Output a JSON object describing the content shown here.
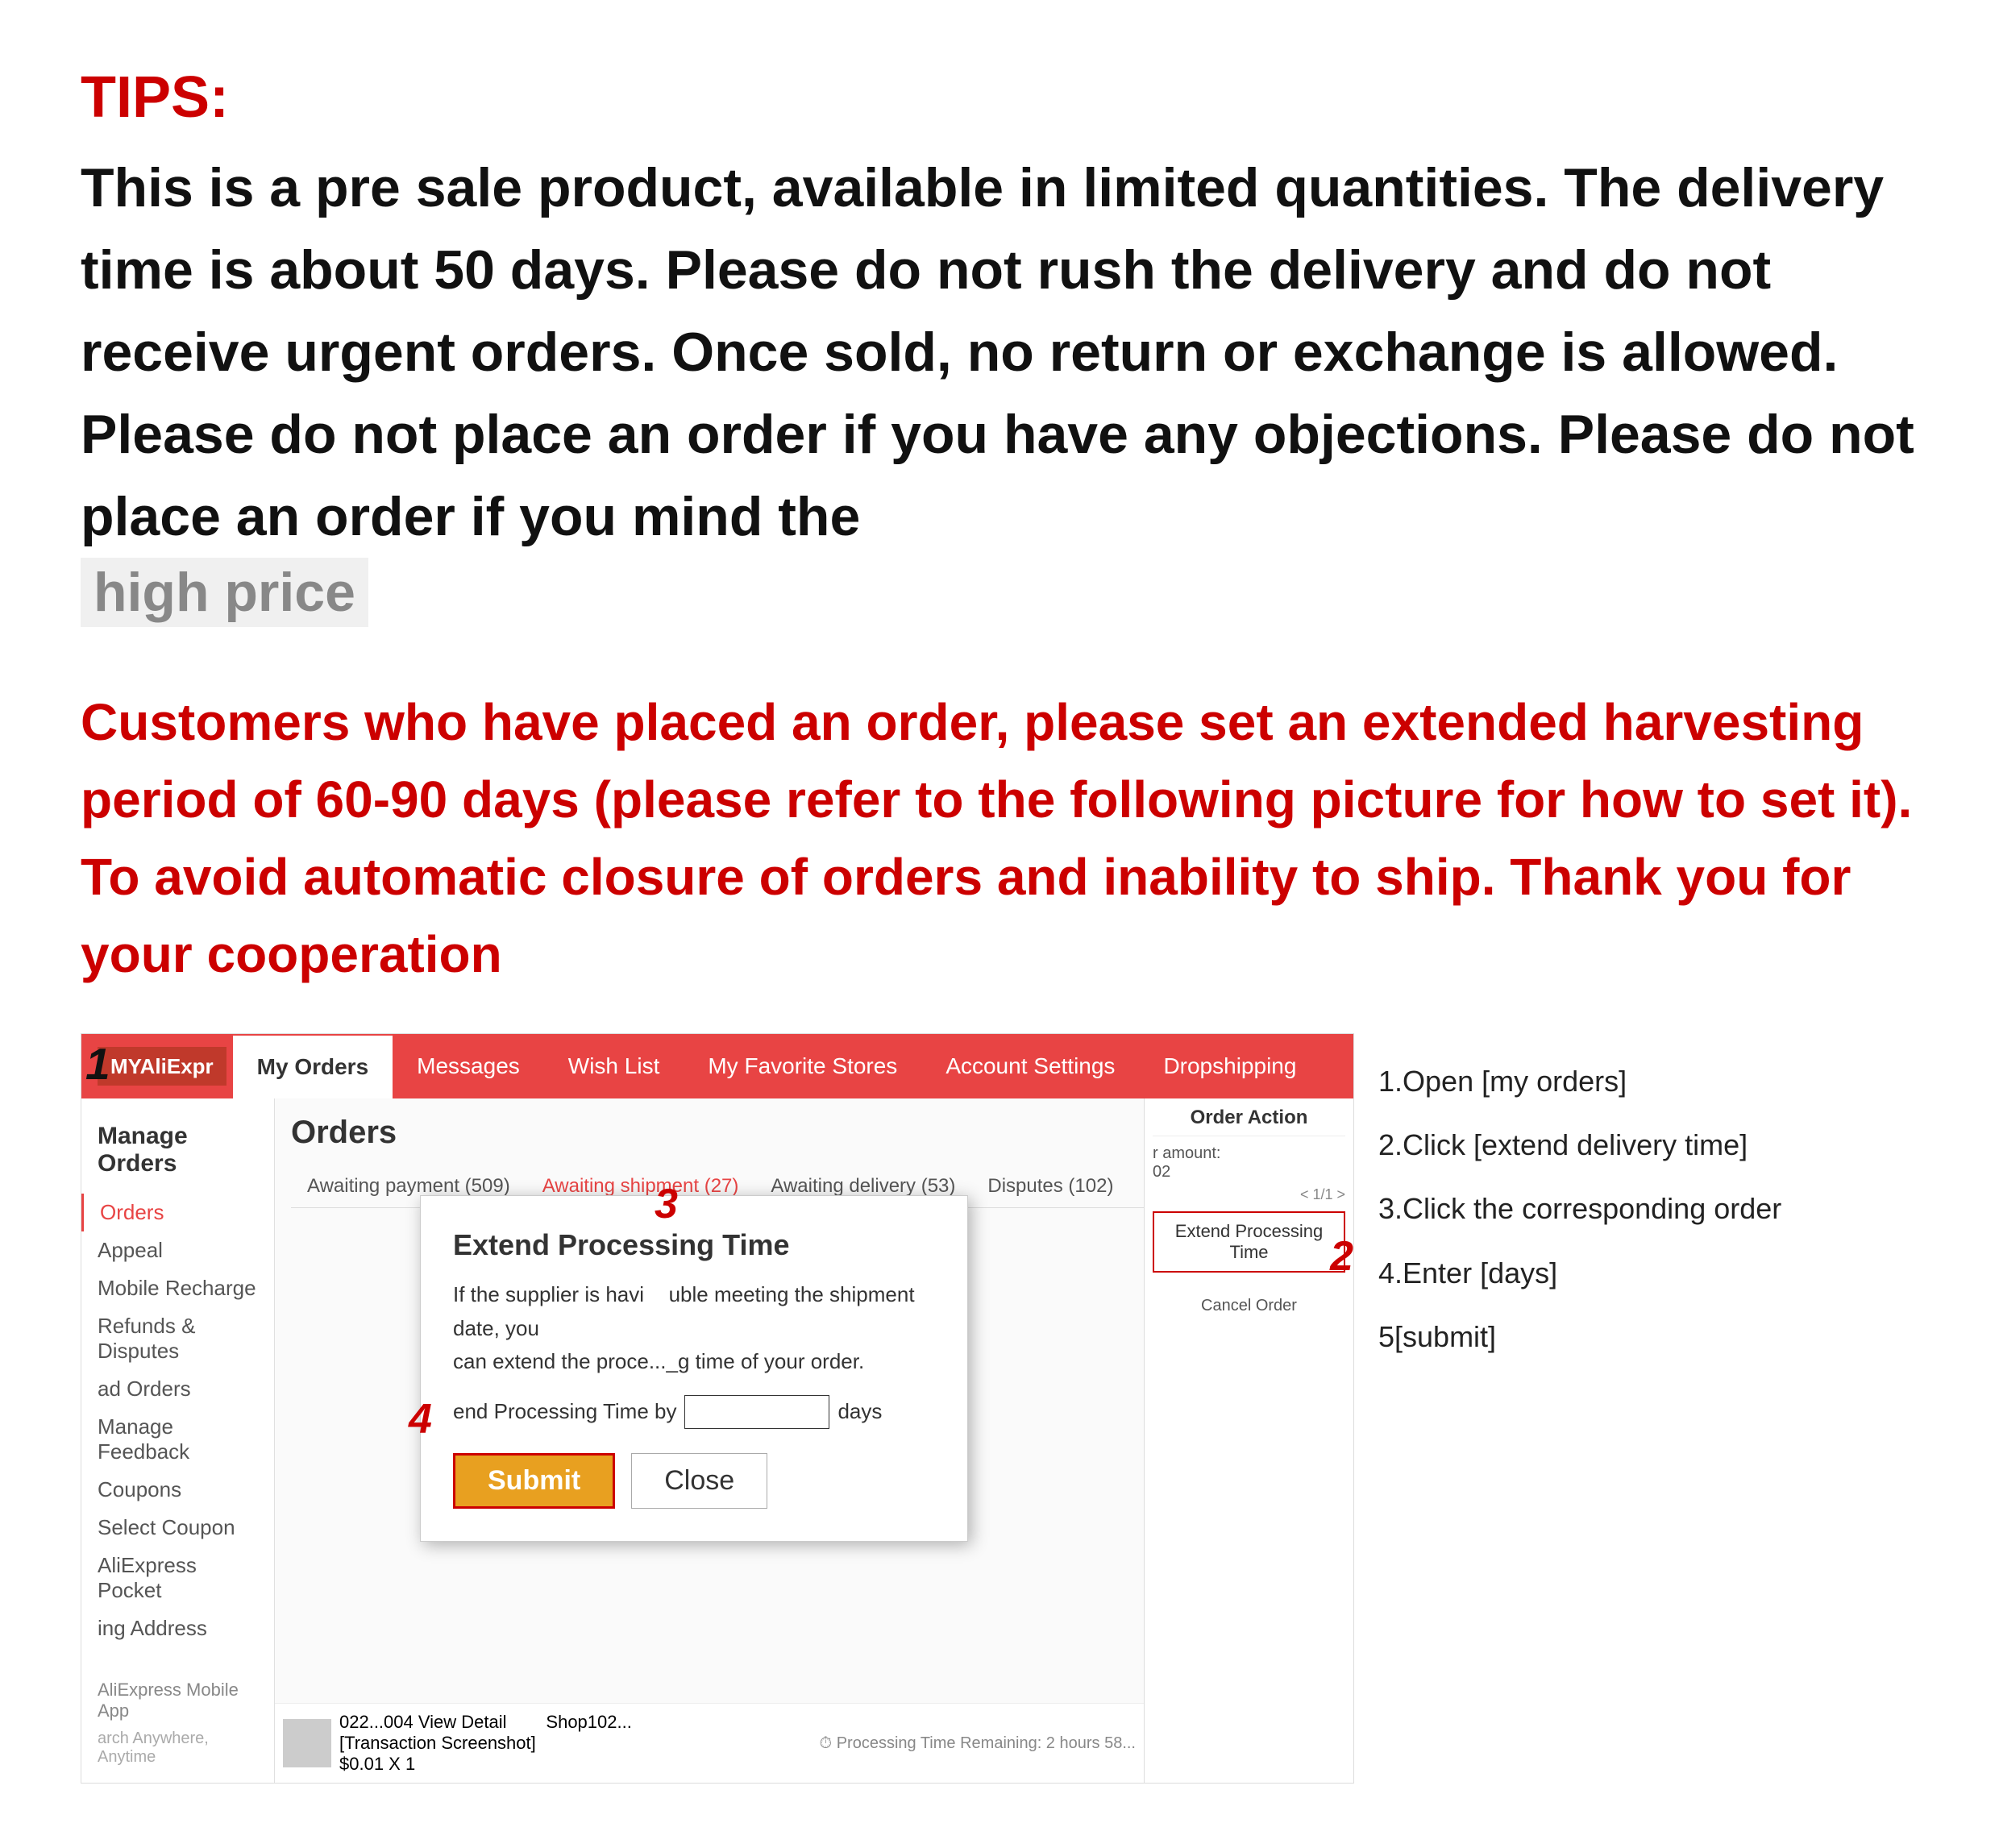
{
  "tips": {
    "label": "TIPS:",
    "body": "This is a pre sale product, available in limited quantities. The delivery time is about 50 days. Please do not rush the delivery and do not receive urgent orders. Once sold, no return or exchange is allowed. Please do not place an order if you have any objections. Please do not place an order if you mind the",
    "high_price": "high price"
  },
  "red_notice": "Customers who have placed an order, please set an extended harvesting period of 60-90 days (please refer to the following picture for how to set it). To avoid automatic closure of orders and inability to ship. Thank you for your cooperation",
  "instructions": {
    "step1": "1.Open [my orders]",
    "step2": "2.Click [extend  delivery  time]",
    "step3": "3.Click the corresponding order",
    "step4": "4.Enter [days]",
    "step5": "5[submit]"
  },
  "header": {
    "logo": "AliExpr",
    "nav_items": [
      {
        "label": "My Orders",
        "active": true
      },
      {
        "label": "Messages",
        "active": false
      },
      {
        "label": "Wish List",
        "active": false
      },
      {
        "label": "My Favorite Stores",
        "active": false
      },
      {
        "label": "Account Settings",
        "active": false
      },
      {
        "label": "Dropshipping",
        "active": false
      }
    ]
  },
  "sidebar": {
    "title": "Manage Orders",
    "items": [
      {
        "label": "Orders",
        "active": true
      },
      {
        "label": "Appeal",
        "active": false
      },
      {
        "label": "Mobile Recharge",
        "active": false
      },
      {
        "label": "Refunds & Disputes",
        "active": false
      },
      {
        "label": "ad Orders",
        "active": false
      },
      {
        "label": "Manage Feedback",
        "active": false
      },
      {
        "label": "Coupons",
        "active": false
      },
      {
        "label": "Select Coupon",
        "active": false
      },
      {
        "label": "AliExpress Pocket",
        "active": false
      },
      {
        "label": "ing Address",
        "active": false
      }
    ]
  },
  "main": {
    "title": "Orders",
    "tabs": [
      {
        "label": "Awaiting payment (509)",
        "active": false
      },
      {
        "label": "Awaiting shipment (27)",
        "active": true
      },
      {
        "label": "Awaiting delivery (53)",
        "active": false
      },
      {
        "label": "Disputes (102)",
        "active": false
      }
    ]
  },
  "modal": {
    "title": "Extend Processing Time",
    "body_line1": "If the supplier is havi",
    "body_line2": "uble meeting the shipment date, you",
    "body_line3": "can extend the proce..._g time of your order.",
    "body_line4": "end Processing Time by",
    "days_label": "days",
    "submit_label": "Submit",
    "close_label": "Close"
  },
  "order_action": {
    "title": "Order Action",
    "amount_label": "r amount:",
    "amount_value": "02",
    "extend_btn_label": "Extend Processing Time",
    "cancel_label": "Cancel Order"
  },
  "order_row": {
    "order_id": "022...004 View Detail",
    "shop": "Shop102...",
    "transaction_label": "[Transaction Screenshot]",
    "price": "$0.01 X 1",
    "processing_time_label": "Processing Time Remaining: 2 hours 58..."
  },
  "footer": {
    "label": "AliExpress Mobile App",
    "sub": "arch Anywhere, Anytime"
  },
  "steps": {
    "s1": "1",
    "s2": "2",
    "s3": "3",
    "s4": "4"
  }
}
